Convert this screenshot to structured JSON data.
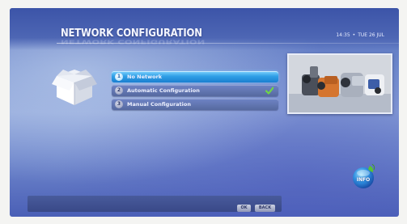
{
  "header": {
    "title": "NETWORK CONFIGURATION",
    "time": "14:35",
    "date": "TUE 26 JUL"
  },
  "menu": {
    "items": [
      {
        "number": "1",
        "label": "No Network",
        "selected": true
      },
      {
        "number": "2",
        "label": "Automatic Configuration",
        "checked": true
      },
      {
        "number": "3",
        "label": "Manual Configuration"
      }
    ]
  },
  "icons": {
    "section_icon": "open-box-icon",
    "status_icon": "checkmark-icon",
    "info_icon": "info-orb-icon"
  },
  "info": {
    "label": "INFO"
  },
  "footer": {
    "ok_label": "OK",
    "back_label": "BACK"
  },
  "colors": {
    "background": "#6f87cc",
    "selected_item": "#2f9fe6",
    "menu_item": "#5d70a8",
    "check": "#5fc23a"
  }
}
